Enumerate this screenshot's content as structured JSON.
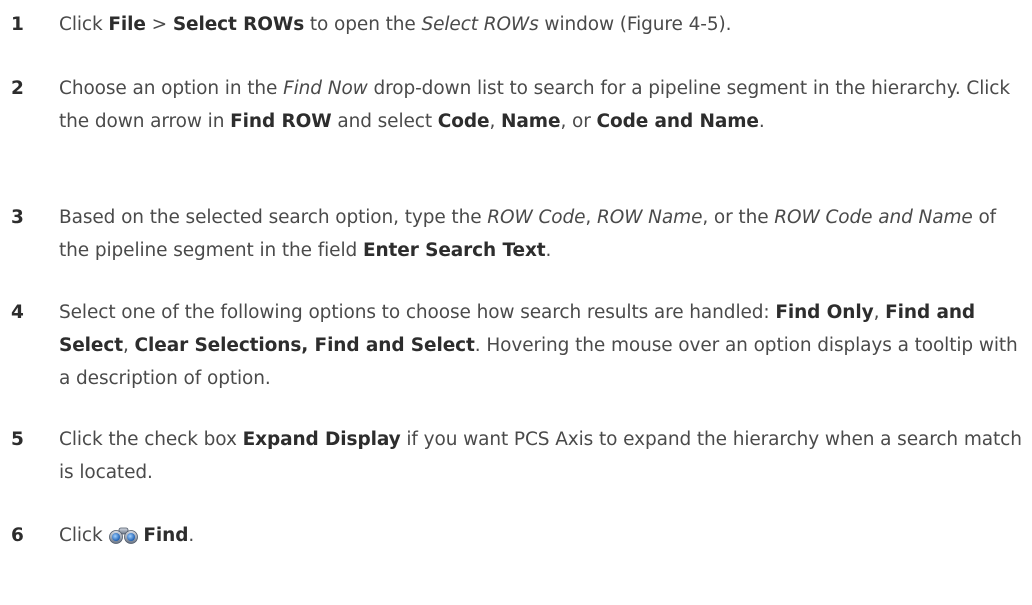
{
  "steps": [
    {
      "number": "1",
      "parts": [
        {
          "t": "Click "
        },
        {
          "t": "File",
          "b": true
        },
        {
          "t": " > "
        },
        {
          "t": "Select ROWs",
          "b": true
        },
        {
          "t": " to open the "
        },
        {
          "t": "Select ROWs",
          "i": true
        },
        {
          "t": " window (Figure 4-5)."
        }
      ]
    },
    {
      "number": "2",
      "parts": [
        {
          "t": "Choose an option in the "
        },
        {
          "t": "Find Now",
          "i": true
        },
        {
          "t": " drop-down list to search for a pipeline segment in the hierarchy. Click the down arrow in "
        },
        {
          "t": "Find ROW",
          "b": true
        },
        {
          "t": " and select "
        },
        {
          "t": "Code",
          "b": true
        },
        {
          "t": ", "
        },
        {
          "t": "Name",
          "b": true
        },
        {
          "t": ", or "
        },
        {
          "t": "Code and Name",
          "b": true
        },
        {
          "t": "."
        }
      ]
    },
    {
      "number": "3",
      "parts": [
        {
          "t": "Based on the selected search option, type the "
        },
        {
          "t": "ROW Code",
          "i": true
        },
        {
          "t": ", "
        },
        {
          "t": "ROW Name",
          "i": true
        },
        {
          "t": ", or the "
        },
        {
          "t": "ROW Code and Name",
          "i": true
        },
        {
          "t": " of the pipeline segment in the field "
        },
        {
          "t": "Enter Search Text",
          "b": true
        },
        {
          "t": "."
        }
      ]
    },
    {
      "number": "4",
      "parts": [
        {
          "t": "Select one of the following options to choose how search results are handled: "
        },
        {
          "t": "Find Only",
          "b": true
        },
        {
          "t": ", "
        },
        {
          "t": "Find and Select",
          "b": true
        },
        {
          "t": ", "
        },
        {
          "t": "Clear Selections, Find and Select",
          "b": true
        },
        {
          "t": ". Hovering the mouse over an option displays a tooltip with a description of option."
        }
      ]
    },
    {
      "number": "5",
      "parts": [
        {
          "t": "Click the check box "
        },
        {
          "t": "Expand Display",
          "b": true
        },
        {
          "t": " if you want PCS Axis to expand the hierarchy when a search match is located."
        }
      ]
    },
    {
      "number": "6",
      "parts": [
        {
          "t": "Click "
        },
        {
          "icon": "binoculars-icon"
        },
        {
          "t": "Find",
          "b": true
        },
        {
          "t": "."
        }
      ]
    }
  ]
}
